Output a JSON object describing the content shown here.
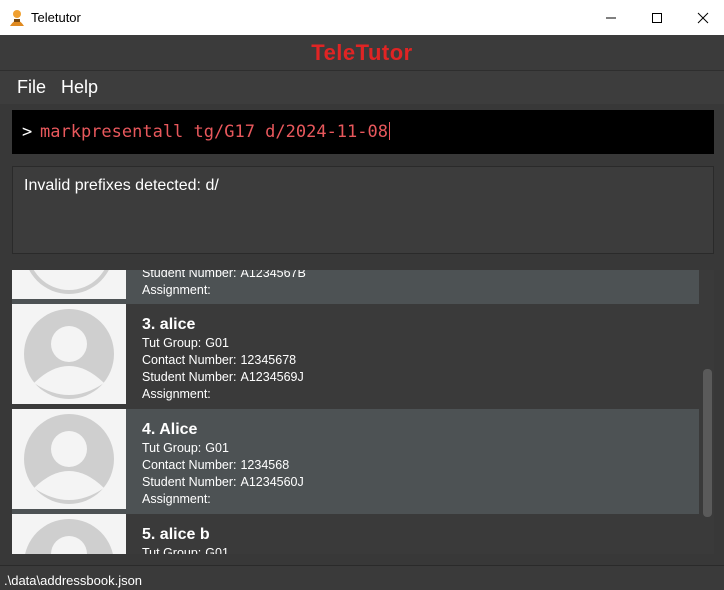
{
  "window": {
    "title": "Teletutor",
    "minimize_icon": "minimize-icon",
    "maximize_icon": "maximize-icon",
    "close_icon": "close-icon"
  },
  "app": {
    "header_title": "TeleTutor",
    "header_color": "#e02424"
  },
  "menu": {
    "file": "File",
    "help": "Help"
  },
  "command": {
    "prompt": ">",
    "value": "markpresentall tg/G17 d/2024-11-08",
    "text_color": "#e8585c"
  },
  "result": {
    "message": "Invalid prefixes detected: d/"
  },
  "students": [
    {
      "index_name": "",
      "fields": [
        {
          "label": "Student Number:",
          "value": "A1234567B"
        },
        {
          "label": "Assignment:",
          "value": ""
        }
      ]
    },
    {
      "index_name": "3. alice",
      "fields": [
        {
          "label": "Tut Group:",
          "value": "G01"
        },
        {
          "label": "Contact Number:",
          "value": "12345678"
        },
        {
          "label": "Student Number:",
          "value": "A1234569J"
        },
        {
          "label": "Assignment:",
          "value": ""
        }
      ]
    },
    {
      "index_name": "4. Alice",
      "fields": [
        {
          "label": "Tut Group:",
          "value": "G01"
        },
        {
          "label": "Contact Number:",
          "value": "1234568"
        },
        {
          "label": "Student Number:",
          "value": "A1234560J"
        },
        {
          "label": "Assignment:",
          "value": ""
        }
      ]
    },
    {
      "index_name": "5. alice b",
      "fields": [
        {
          "label": "Tut Group:",
          "value": "G01"
        }
      ]
    }
  ],
  "status": {
    "file_path": ".\\data\\addressbook.json"
  }
}
